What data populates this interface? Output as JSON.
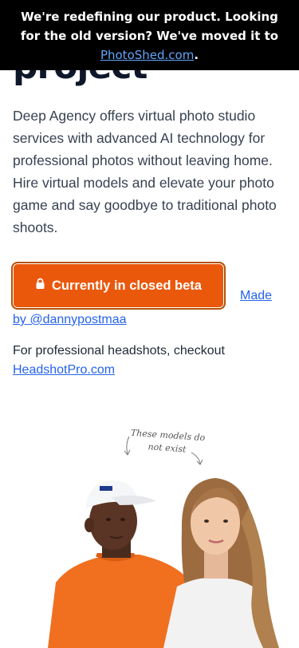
{
  "banner": {
    "text": "We're redefining our product. Looking for the old version? We've moved it to",
    "link_text": "PhotoShed.com",
    "trailing": "."
  },
  "hero": {
    "heading_peek": "project"
  },
  "description": "Deep Agency offers virtual photo studio services with advanced AI technology for professional photos without leaving home. Hire virtual models and elevate your photo game and say goodbye to traditional photo shoots.",
  "cta": {
    "beta_label": "Currently in closed beta",
    "beta_icon": "lock-icon",
    "made_label": "Made",
    "by_label": "by @dannypostmaa"
  },
  "headshots": {
    "text": "For professional headshots, checkout",
    "link_text": "HeadshotPro.com"
  },
  "models": {
    "note_line1": "These models do",
    "note_line2": "not exist"
  },
  "colors": {
    "accent": "#ea580c",
    "link": "#2563eb",
    "banner_bg": "#000000"
  }
}
